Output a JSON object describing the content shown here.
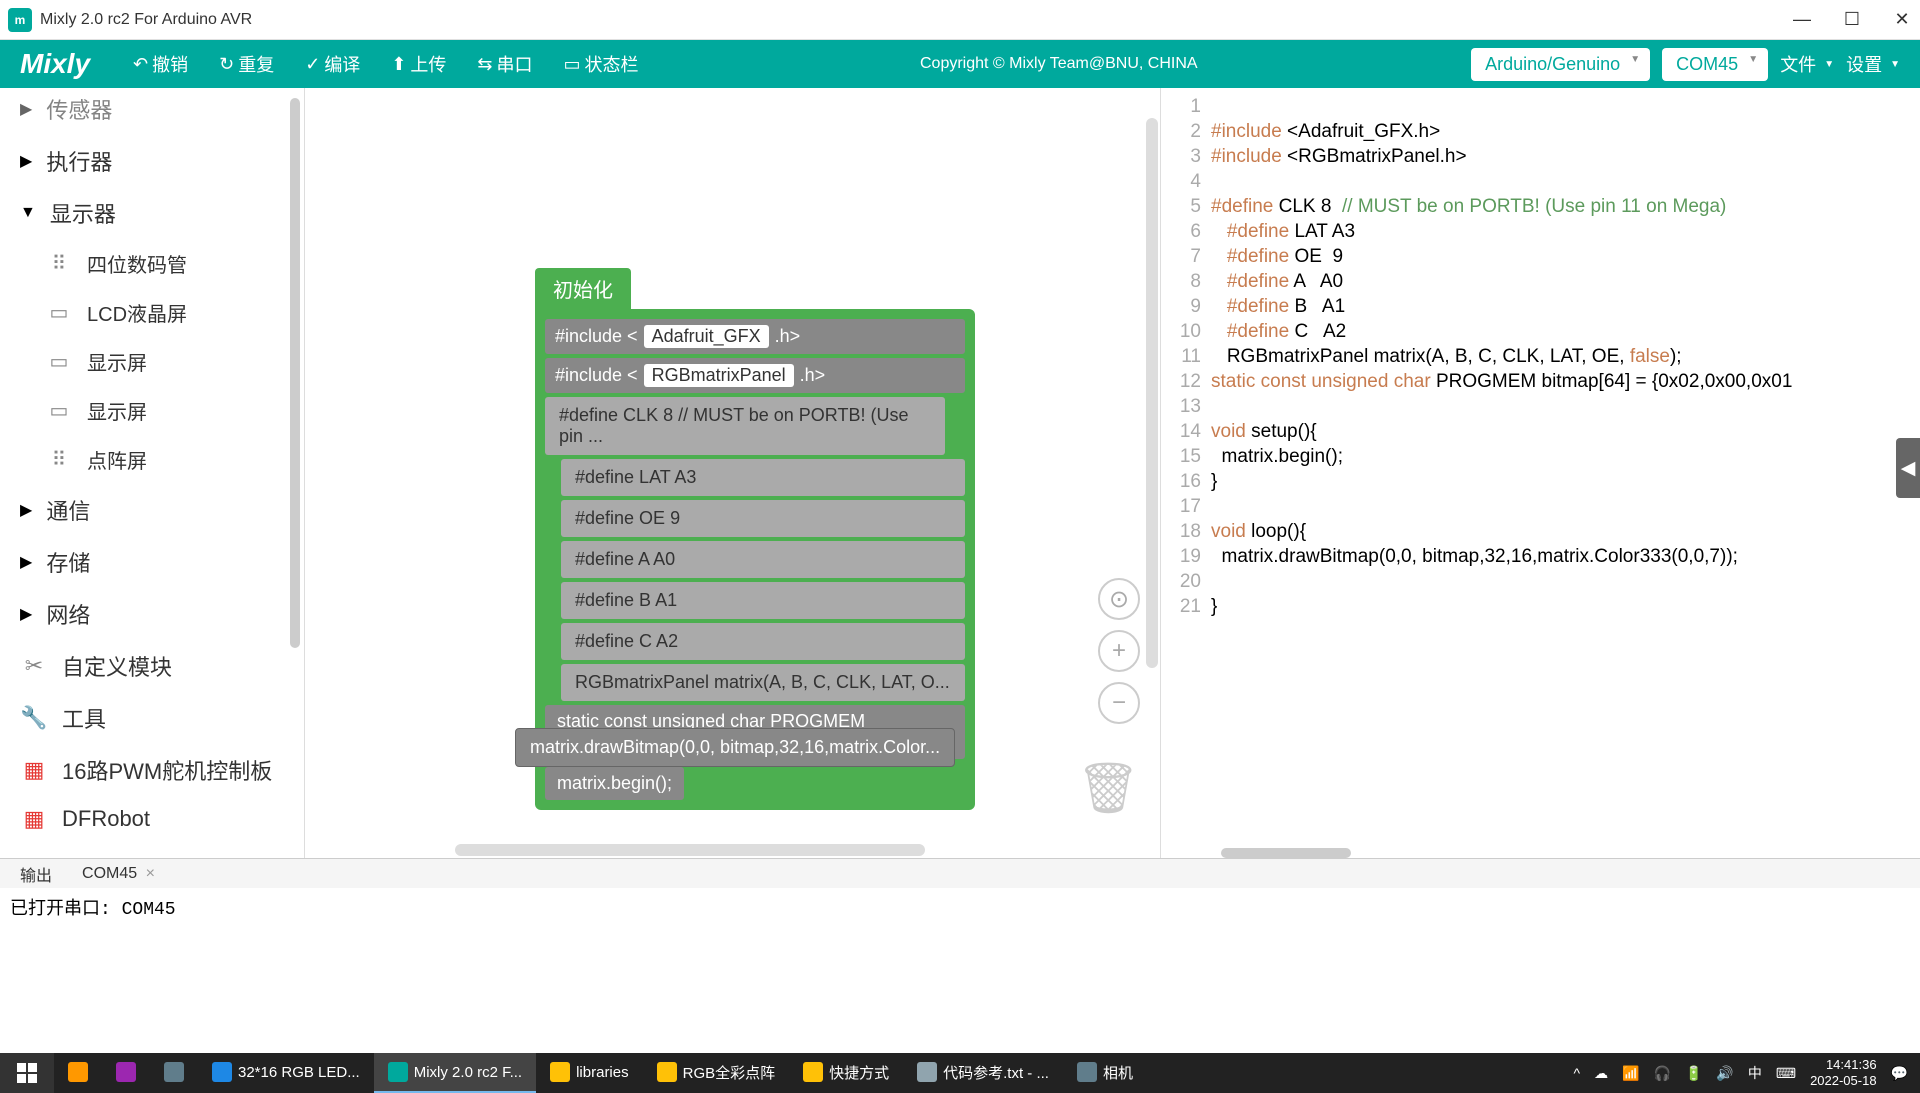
{
  "titlebar": {
    "text": "Mixly 2.0 rc2 For Arduino AVR"
  },
  "toolbar": {
    "logo": "Mixly",
    "undo": "撤销",
    "redo": "重复",
    "compile": "编译",
    "upload": "上传",
    "serial": "串口",
    "statusbar": "状态栏",
    "copyright": "Copyright © Mixly Team@BNU, CHINA",
    "board": "Arduino/Genuino",
    "port": "COM45",
    "file": "文件",
    "settings": "设置"
  },
  "sidebar": {
    "sensor": "传感器",
    "actuator": "执行器",
    "display": "显示器",
    "fourDigit": "四位数码管",
    "lcd": "LCD液晶屏",
    "screen1": "显示屏",
    "screen2": "显示屏",
    "matrix": "点阵屏",
    "comm": "通信",
    "storage": "存储",
    "network": "网络",
    "custom": "自定义模块",
    "tools": "工具",
    "pwm": "16路PWM舵机控制板",
    "dfrobot": "DFRobot"
  },
  "blocks": {
    "init": "初始化",
    "includePrefix": "#include <",
    "includeSuffix1": " .h>",
    "includeSuffix2": " .h>",
    "gfx": "Adafruit_GFX",
    "rgb": "RGBmatrixPanel",
    "def1": "#define CLK 8  // MUST be on PORTB! (Use pin ...",
    "def2": "#define LAT A3",
    "def3": "#define OE  9",
    "def4": "#define A   A0",
    "def5": "#define B   A1",
    "def6": "#define C   A2",
    "def7": "RGBmatrixPanel matrix(A, B, C, CLK, LAT, O...",
    "def8": "static const unsigned char PROGMEM bitmap[64]...",
    "begin": "matrix.begin();",
    "loose": "matrix.drawBitmap(0,0, bitmap,32,16,matrix.Color..."
  },
  "code": {
    "lines": [
      "1",
      "2",
      "3",
      "4",
      "5",
      "6",
      "7",
      "8",
      "9",
      "10",
      "11",
      "12",
      "13",
      "14",
      "15",
      "16",
      "17",
      "18",
      "19",
      "20",
      "21"
    ],
    "l2a": "#include",
    "l2b": " <Adafruit_GFX.h>",
    "l3a": "#include",
    "l3b": " <RGBmatrixPanel.h>",
    "l5a": "#define",
    "l5b": " CLK 8  ",
    "l5c": "// MUST be on PORTB! (Use pin 11 on Mega)",
    "l6a": "#define",
    "l6b": " LAT A3",
    "l7a": "#define",
    "l7b": " OE  9",
    "l8a": "#define",
    "l8b": " A   A0",
    "l9a": "#define",
    "l9b": " B   A1",
    "l10a": "#define",
    "l10b": " C   A2",
    "l11": "   RGBmatrixPanel matrix(A, B, C, CLK, LAT, OE, ",
    "l11b": "false",
    "l11c": ");",
    "l12a": "static const unsigned char",
    "l12b": " PROGMEM bitmap[64] = {0x02,0x00,0x01",
    "l14a": "void",
    "l14b": " setup(){",
    "l15": "  matrix.begin();",
    "l16": "}",
    "l18a": "void",
    "l18b": " loop(){",
    "l19": "  matrix.drawBitmap(0,0, bitmap,32,16,matrix.Color333(0,0,7));",
    "l21": "}"
  },
  "bottomTabs": {
    "output": "输出",
    "port": "COM45"
  },
  "console": {
    "text": "已打开串口: COM45"
  },
  "taskbar": {
    "items": [
      {
        "label": "32*16 RGB LED...",
        "color": "#1e88e5"
      },
      {
        "label": "Mixly 2.0 rc2 F...",
        "color": "#00a99d"
      },
      {
        "label": "libraries",
        "color": "#ffc107"
      },
      {
        "label": "RGB全彩点阵",
        "color": "#ffc107"
      },
      {
        "label": "快捷方式",
        "color": "#ffc107"
      },
      {
        "label": "代码参考.txt - ...",
        "color": "#90a4ae"
      },
      {
        "label": "相机",
        "color": "#607d8b"
      }
    ],
    "time": "14:41:36",
    "date": "2022-05-18"
  }
}
